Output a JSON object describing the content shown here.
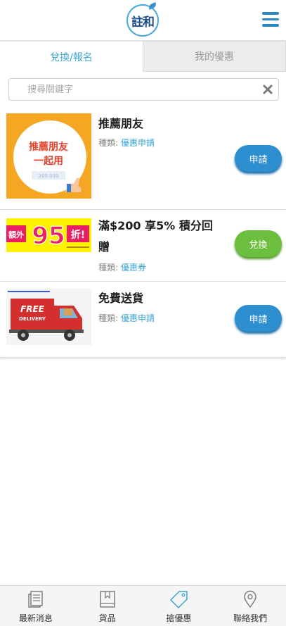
{
  "header": {
    "logo_text": "註和",
    "menu_icon": "hamburger-menu-icon"
  },
  "tabs": [
    {
      "label": "兌換/報名",
      "active": true
    },
    {
      "label": "我的優惠",
      "active": false
    }
  ],
  "search": {
    "placeholder": "搜尋關鍵字",
    "value": ""
  },
  "type_label": "種類:",
  "coupons": [
    {
      "title": "推薦朋友",
      "type_value": "優惠申請",
      "button_label": "申請",
      "button_color": "#2d8fd0",
      "thumb_text_line1": "推薦朋友",
      "thumb_text_line2": "一起用",
      "thumb_code": "200 000"
    },
    {
      "title": "滿$200 享5% 積分回贈",
      "type_value": "優惠券",
      "button_label": "兌換",
      "button_color": "#6cbf3e",
      "thumb_text_prefix": "額外",
      "thumb_text_number": "95",
      "thumb_text_suffix": "折!"
    },
    {
      "title": "免費送貨",
      "type_value": "優惠申請",
      "button_label": "申請",
      "button_color": "#2d8fd0",
      "thumb_text_line1": "FREE",
      "thumb_text_line2": "DELIVERY"
    }
  ],
  "bottom_nav": [
    {
      "label": "最新消息",
      "icon": "news-icon",
      "active": false
    },
    {
      "label": "貨品",
      "icon": "book-icon",
      "active": false
    },
    {
      "label": "搶優惠",
      "icon": "tag-icon",
      "active": true
    },
    {
      "label": "聯絡我們",
      "icon": "location-pin-icon",
      "active": false
    }
  ],
  "colors": {
    "accent": "#3aa6d3",
    "primary_button": "#2d8fd0",
    "success_button": "#6cbf3e"
  }
}
